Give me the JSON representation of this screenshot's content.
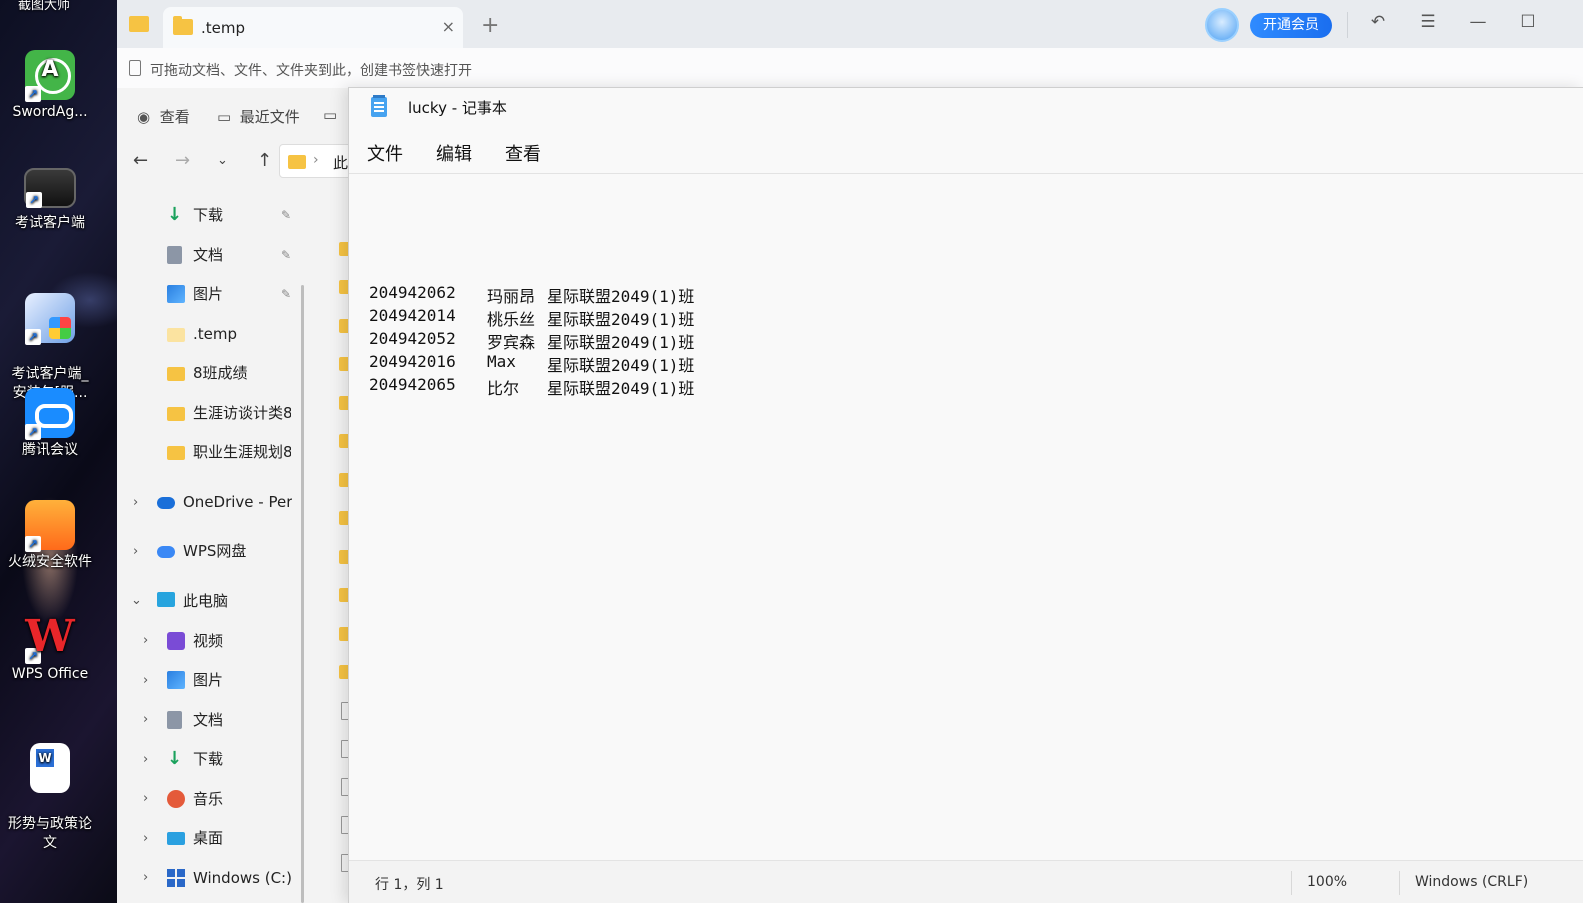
{
  "desktop": {
    "top_text": "截图大师",
    "icons": [
      {
        "label": "SwordAg..."
      },
      {
        "label": "考试客户端"
      },
      {
        "label": "考试客户端_\n安装包[服..."
      },
      {
        "label": "腾讯会议"
      },
      {
        "label": "火绒安全软件"
      },
      {
        "label": "WPS Office"
      },
      {
        "label": "形势与政策论\n文"
      }
    ]
  },
  "explorer": {
    "tab_title": ".temp",
    "tab_close": "×",
    "tab_add": "+",
    "vip_button": "开通会员",
    "bookmark_hint": "可拖动文档、文件、文件夹到此，创建书签快速打开",
    "commands": {
      "view": "查看",
      "recent": "最近文件"
    },
    "address_tail": "此",
    "quick_access": [
      {
        "label": "下载",
        "icon": "download-icon",
        "pinned": true
      },
      {
        "label": "文档",
        "icon": "documents-icon",
        "pinned": true
      },
      {
        "label": "图片",
        "icon": "pictures-icon",
        "pinned": true
      },
      {
        "label": ".temp",
        "icon": "folder-icon",
        "pinned": false
      },
      {
        "label": "8班成绩",
        "icon": "folder-icon",
        "pinned": false
      },
      {
        "label": "生涯访谈计类8",
        "icon": "folder-icon",
        "pinned": false
      },
      {
        "label": "职业生涯规划8",
        "icon": "folder-icon",
        "pinned": false
      }
    ],
    "onedrive": "OneDrive - Pers",
    "wps_cloud": "WPS网盘",
    "this_pc": "此电脑",
    "pc_items": [
      {
        "label": "视频"
      },
      {
        "label": "图片"
      },
      {
        "label": "文档"
      },
      {
        "label": "下载"
      },
      {
        "label": "音乐"
      },
      {
        "label": "桌面"
      },
      {
        "label": "Windows (C:)"
      }
    ]
  },
  "notepad": {
    "title": "lucky - 记事本",
    "menu": {
      "file": "文件",
      "edit": "编辑",
      "view": "查看"
    },
    "rows": [
      {
        "id": "204942062",
        "name": "玛丽昂",
        "class": "星际联盟2049(1)班"
      },
      {
        "id": "204942014",
        "name": "桃乐丝",
        "class": "星际联盟2049(1)班"
      },
      {
        "id": "204942052",
        "name": "罗宾森",
        "class": "星际联盟2049(1)班"
      },
      {
        "id": "204942016",
        "name": "Max",
        "class": "星际联盟2049(1)班"
      },
      {
        "id": "204942065",
        "name": "比尔",
        "class": "星际联盟2049(1)班"
      }
    ],
    "status": {
      "position": "行 1，列 1",
      "zoom": "100%",
      "encoding": "Windows (CRLF)"
    }
  }
}
